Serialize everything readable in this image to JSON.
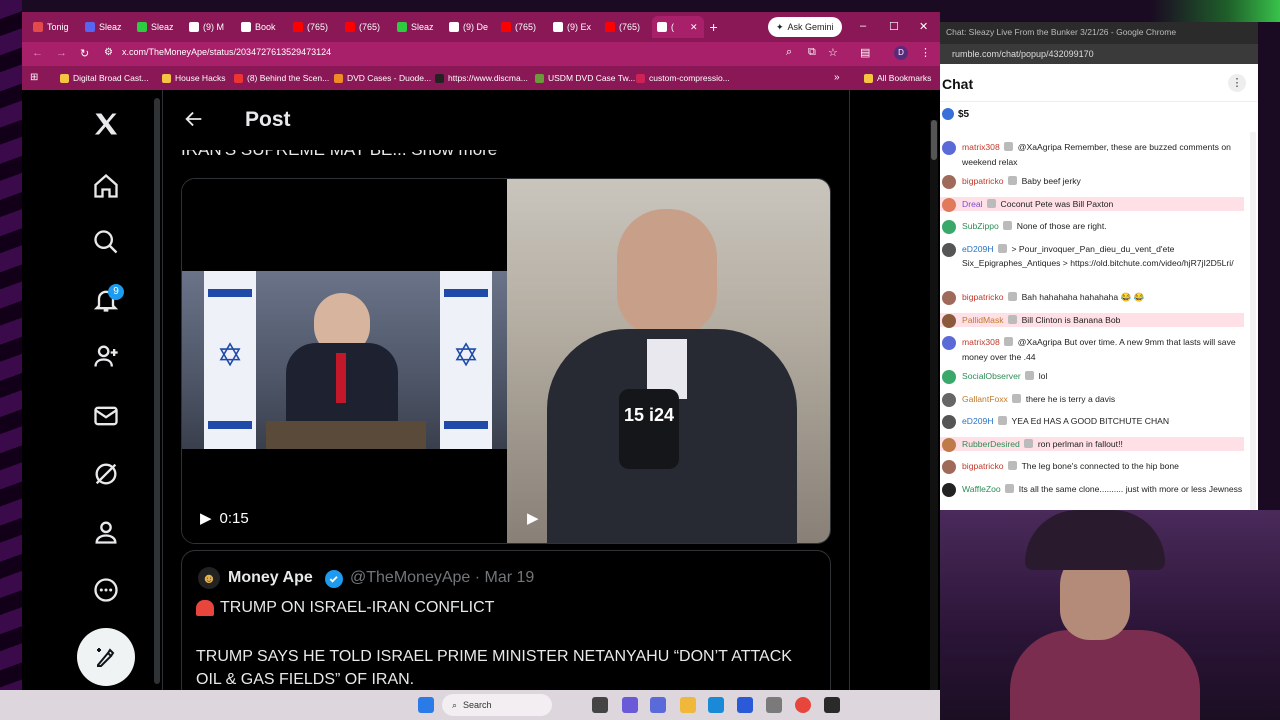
{
  "browser": {
    "tabs": [
      {
        "label": "Tonig",
        "color": "#e34b4b"
      },
      {
        "label": "Sleaz",
        "color": "#5865f2"
      },
      {
        "label": "Sleaz",
        "color": "#2ecc40"
      },
      {
        "label": "(9) M",
        "color": "#ffffff"
      },
      {
        "label": "Book",
        "color": "#ffffff"
      },
      {
        "label": "(765)",
        "color": "#ff0000"
      },
      {
        "label": "(765)",
        "color": "#ff0000"
      },
      {
        "label": "Sleaz",
        "color": "#2ecc40"
      },
      {
        "label": "(9) De",
        "color": "#ffffff"
      },
      {
        "label": "(765)",
        "color": "#ff0000"
      },
      {
        "label": "(9) Ex",
        "color": "#ffffff"
      },
      {
        "label": "(765)",
        "color": "#ff0000"
      },
      {
        "label": "(",
        "color": "#ffffff"
      }
    ],
    "new_tab": "+",
    "ask_gemini": "Ask Gemini",
    "url": "x.com/TheMoneyApe/status/2034727613529473124",
    "bookmarks": [
      "Digital Broad Cast...",
      "House Hacks",
      "(8) Behind the Scen...",
      "DVD Cases - Duode...",
      "https://www.discma...",
      "USDM DVD Case Tw...",
      "custom-compressio..."
    ],
    "all_bookmarks": "All Bookmarks",
    "profile_initial": "D"
  },
  "x": {
    "notification_count": "9",
    "header_title": "Post",
    "truncated_text": "IRAN'S SUPREME MAY BE... Show more",
    "video_time": "0:15",
    "quote": {
      "name": "Money Ape",
      "handle": "@TheMoneyApe · Mar 19",
      "headline": "TRUMP ON ISRAEL-IRAN CONFLICT",
      "body": "TRUMP SAYS HE TOLD ISRAEL PRIME MINISTER NETANYAHU “DON’T ATTACK OIL & GAS FIELDS” OF IRAN."
    },
    "mic_label": "15 i24"
  },
  "taskbar": {
    "search": "Search"
  },
  "chat": {
    "window_title": "Chat: Sleazy Live From the Bunker 3/21/26 - Google Chrome",
    "url": "rumble.com/chat/popup/432099170",
    "label": "Chat",
    "rant_amount": "$5",
    "messages": [
      {
        "user": "matrix308",
        "color": "#c0392b",
        "avatar": "#5a6bd8",
        "text": "@XaAgripa Remember, these are buzzed comments on weekend relax",
        "lines": 2,
        "hl": false
      },
      {
        "user": "bigpatricko",
        "color": "#c0392b",
        "avatar": "#a06a5a",
        "text": "Baby beef jerky",
        "lines": 1,
        "hl": false
      },
      {
        "user": "Dreal",
        "color": "#7b4dd6",
        "avatar": "#e07a5a",
        "text": "Coconut Pete was Bill Paxton",
        "lines": 1,
        "hl": true
      },
      {
        "user": "SubZippo",
        "color": "#2e8b57",
        "avatar": "#3aa86a",
        "text": "None of those are right.",
        "lines": 1,
        "hl": false
      },
      {
        "user": "eD209H",
        "color": "#2a72c4",
        "avatar": "#555555",
        "text": "> Pour_invoquer_Pan_dieu_du_vent_d'ete Six_Epigraphes_Antiques > https://old.bitchute.com/video/hjR7jI2D5Lri/",
        "lines": 3,
        "hl": false
      },
      {
        "user": "bigpatricko",
        "color": "#c0392b",
        "avatar": "#a06a5a",
        "text": "Bah hahahaha hahahaha 😂 😂",
        "lines": 1,
        "hl": false
      },
      {
        "user": "PallidMask",
        "color": "#c07a2a",
        "avatar": "#8a5a3a",
        "text": "Bill Clinton is Banana Bob",
        "lines": 1,
        "hl": true
      },
      {
        "user": "matrix308",
        "color": "#c0392b",
        "avatar": "#5a6bd8",
        "text": "@XaAgripa But over time. A new 9mm that lasts will save money over the .44",
        "lines": 2,
        "hl": false
      },
      {
        "user": "SocialObserver",
        "color": "#2e8b57",
        "avatar": "#3aa86a",
        "text": "lol",
        "lines": 1,
        "hl": false
      },
      {
        "user": "GallantFoxx",
        "color": "#c07a2a",
        "avatar": "#666666",
        "text": "there he is terry a davis",
        "lines": 1,
        "hl": false
      },
      {
        "user": "eD209H",
        "color": "#2a72c4",
        "avatar": "#555555",
        "text": "YEA Ed HAS A GOOD BITCHUTE CHAN",
        "lines": 1,
        "hl": false
      },
      {
        "user": "RubberDesired",
        "color": "#2e8b57",
        "avatar": "#c07a4a",
        "text": "ron perlman in fallout!!",
        "lines": 1,
        "hl": true
      },
      {
        "user": "bigpatricko",
        "color": "#c0392b",
        "avatar": "#a06a5a",
        "text": "The leg bone's connected to the hip bone",
        "lines": 1,
        "hl": false
      },
      {
        "user": "WaffleZoo",
        "color": "#2e8b57",
        "avatar": "#222222",
        "text": "Its all the same clone.......... just with more or less Jewness",
        "lines": 2,
        "hl": false
      }
    ]
  }
}
